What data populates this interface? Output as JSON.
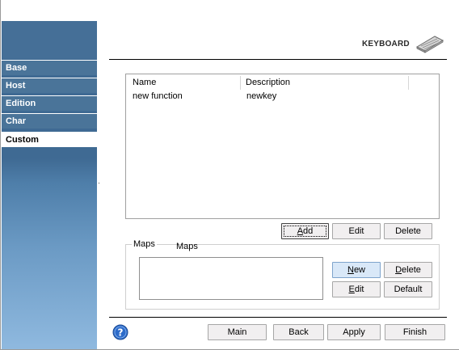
{
  "sidebar": {
    "items": [
      {
        "label": "Base",
        "active": false
      },
      {
        "label": "Host",
        "active": false
      },
      {
        "label": "Edition",
        "active": false
      },
      {
        "label": "Char",
        "active": false
      },
      {
        "label": "Custom",
        "active": true
      }
    ]
  },
  "header": {
    "title": "KEYBOARD",
    "icon": "keyboard-icon"
  },
  "functions": {
    "columns": [
      "Name",
      "Description"
    ],
    "rows": [
      {
        "name": "new function",
        "description": "newkey"
      }
    ],
    "buttons": {
      "add": "Add",
      "edit": "Edit",
      "delete": "Delete"
    }
  },
  "maps": {
    "group_label": "Maps",
    "list_label": "Maps",
    "buttons": {
      "new": "New",
      "delete": "Delete",
      "edit": "Edit",
      "default": "Default"
    }
  },
  "footer": {
    "help_icon": "help-icon",
    "buttons": {
      "main": "Main",
      "back": "Back",
      "apply": "Apply",
      "finish": "Finish"
    }
  },
  "colors": {
    "sidebar": "#456f97",
    "sidebar_bottom": "#8fb9df",
    "button_face": "#f1eff0",
    "help_blue": "#2d6bc9"
  }
}
